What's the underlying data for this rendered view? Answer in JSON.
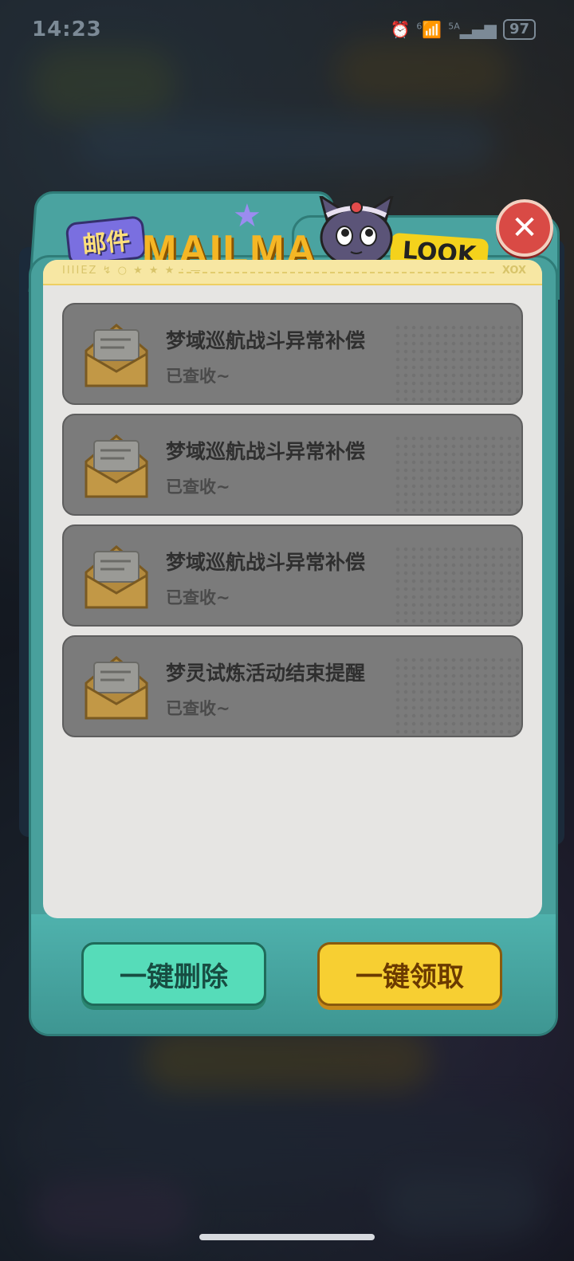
{
  "status_bar": {
    "time": "14:23",
    "network": "5A",
    "signal_sup": "6",
    "battery": "97"
  },
  "dialog": {
    "title_cn": "邮件",
    "title_en": "MAILMA",
    "look_badge": "LOOK",
    "header_deco": "IIIIEZ ↯ ○ ★ ★ ★ · —",
    "header_deco_right": "XOX",
    "close_icon": "close-icon"
  },
  "mails": [
    {
      "title": "梦域巡航战斗异常补偿",
      "status": "已查收~"
    },
    {
      "title": "梦域巡航战斗异常补偿",
      "status": "已查收~"
    },
    {
      "title": "梦域巡航战斗异常补偿",
      "status": "已查收~"
    },
    {
      "title": "梦灵试炼活动结束提醒",
      "status": "已查收~"
    }
  ],
  "buttons": {
    "delete_all": "一键删除",
    "claim_all": "一键领取"
  }
}
